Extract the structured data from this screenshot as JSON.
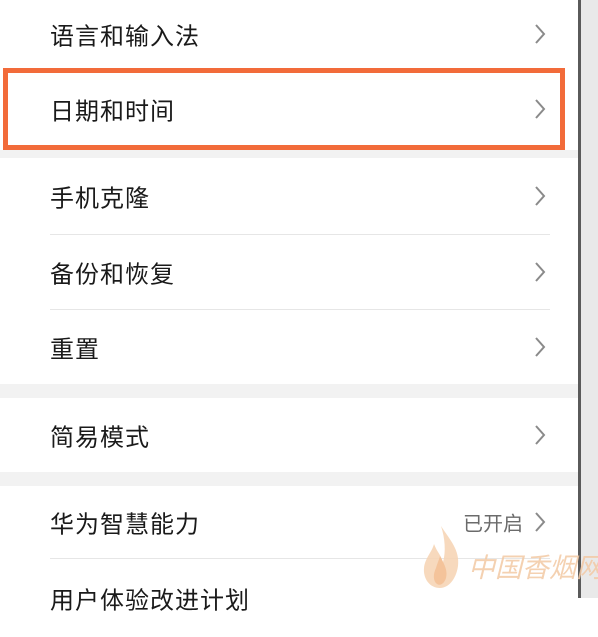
{
  "settings": {
    "items": [
      {
        "label": "语言和输入法"
      },
      {
        "label": "日期和时间",
        "highlighted": true
      },
      {
        "label": "手机克隆"
      },
      {
        "label": "备份和恢复"
      },
      {
        "label": "重置"
      },
      {
        "label": "简易模式"
      },
      {
        "label": "华为智慧能力",
        "status": "已开启"
      },
      {
        "label": "用户体验改进计划"
      }
    ]
  },
  "icons": {
    "chevron": "chevron-right-icon",
    "watermark_logo": "flame-logo-icon"
  },
  "colors": {
    "highlight": "#f26b3a",
    "section_gap": "#f2f2f2",
    "chevron": "#8a8a8a"
  },
  "watermark": {
    "text": "中国香烟网"
  }
}
